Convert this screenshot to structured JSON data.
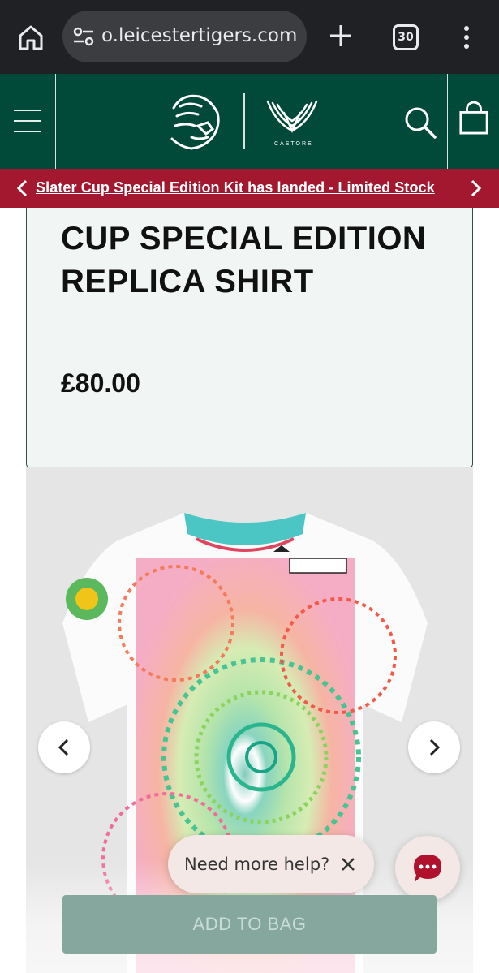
{
  "browser": {
    "url_text": "o.leicestertigers.com",
    "tab_count": "30",
    "icons": [
      "home-icon",
      "tune-icon",
      "plus-icon",
      "more-vert-icon"
    ]
  },
  "header": {
    "icons": [
      "menu-icon",
      "tigers-logo",
      "castore-logo",
      "search-icon",
      "bag-icon"
    ],
    "brand_text": "CASTORE"
  },
  "promo": {
    "message": "Slater Cup Special Edition Kit has landed - Limited Stock"
  },
  "product": {
    "title": "CUP SPECIAL EDITION REPLICA SHIRT",
    "price": "£80.00"
  },
  "help": {
    "label": "Need more help?"
  },
  "cta": {
    "add_to_bag": "ADD TO BAG"
  },
  "colors": {
    "header_green": "#014a3a",
    "promo_red": "#a3182f",
    "button_green": "#86a79d"
  }
}
